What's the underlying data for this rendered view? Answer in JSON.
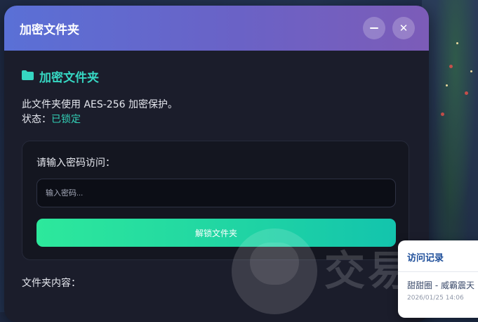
{
  "window": {
    "title": "加密文件夹",
    "minimize_icon": "minus-icon",
    "close_icon": "close-icon"
  },
  "folder": {
    "icon": "folder-icon",
    "name": "加密文件夹",
    "description": "此文件夹使用 AES-256 加密保护。",
    "status_label": "状态：",
    "status_value": "已锁定"
  },
  "password": {
    "label": "请输入密码访问：",
    "placeholder": "输入密码...",
    "unlock_label": "解锁文件夹"
  },
  "contents": {
    "label": "文件夹内容："
  },
  "visit_log": {
    "title": "访问记录",
    "entry_user": "甜甜圈 - 威霸震天",
    "entry_time": "2026/01/25 14:06"
  },
  "watermark": {
    "text": "交易"
  },
  "colors": {
    "accent_teal": "#36d6c2",
    "status_locked": "#33d1b7",
    "titlebar_start": "#5a70d6",
    "titlebar_end": "#7c5cb8",
    "button_start": "#2de89c",
    "button_end": "#13c4ad"
  }
}
